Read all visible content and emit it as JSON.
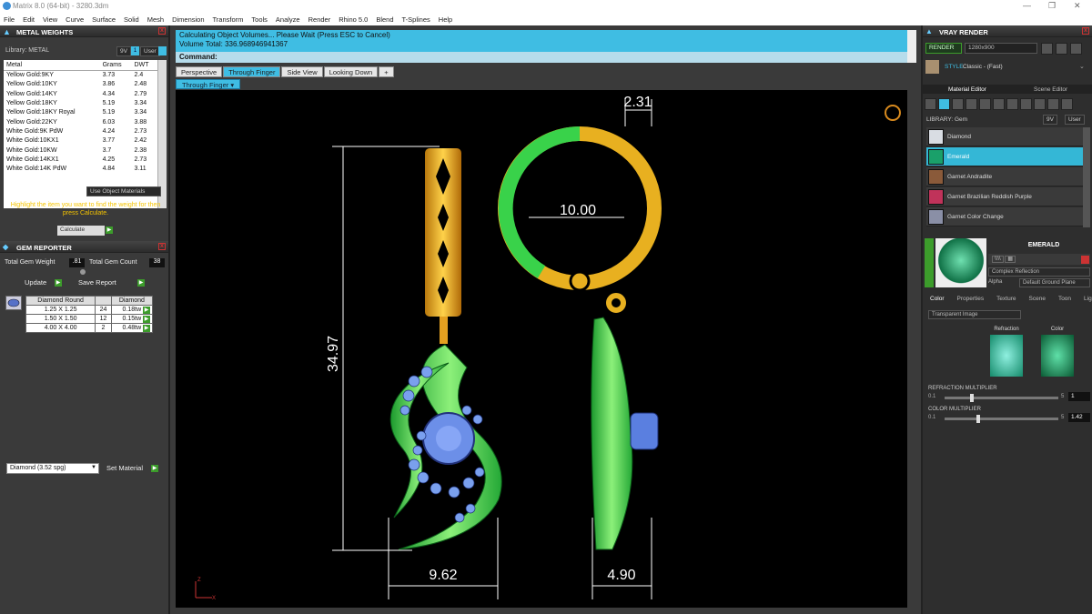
{
  "window": {
    "title": "Matrix 8.0 (64-bit) - 3280.3dm"
  },
  "menu": [
    "File",
    "Edit",
    "View",
    "Curve",
    "Surface",
    "Solid",
    "Mesh",
    "Dimension",
    "Transform",
    "Tools",
    "Analyze",
    "Render",
    "Rhino 5.0",
    "Blend",
    "T-Splines",
    "Help"
  ],
  "metal": {
    "panel_title": "METAL WEIGHTS",
    "library_label": "Library: METAL",
    "lib_btn1": "9V",
    "lib_btn2": "User",
    "headers": [
      "Metal",
      "Grams",
      "DWT"
    ],
    "rows": [
      [
        "Yellow Gold:9KY",
        "3.73",
        "2.4"
      ],
      [
        "Yellow Gold:10KY",
        "3.86",
        "2.48"
      ],
      [
        "Yellow Gold:14KY",
        "4.34",
        "2.79"
      ],
      [
        "Yellow Gold:18KY",
        "5.19",
        "3.34"
      ],
      [
        "Yellow Gold:18KY Royal",
        "5.19",
        "3.34"
      ],
      [
        "Yellow Gold:22KY",
        "6.03",
        "3.88"
      ],
      [
        "White Gold:9K PdW",
        "4.24",
        "2.73"
      ],
      [
        "White Gold:10KX1",
        "3.77",
        "2.42"
      ],
      [
        "White Gold:10KW",
        "3.7",
        "2.38"
      ],
      [
        "White Gold:14KX1",
        "4.25",
        "2.73"
      ],
      [
        "White Gold:14K PdW",
        "4.84",
        "3.11"
      ]
    ],
    "use_object_materials": "Use Object Materials",
    "hint": "Highlight the item you want to find the weight for then press Calculate.",
    "calculate": "Calculate"
  },
  "gem": {
    "panel_title": "GEM REPORTER",
    "total_weight_label": "Total Gem Weight",
    "total_weight": ".81",
    "total_count_label": "Total Gem Count",
    "total_count": "38",
    "update": "Update",
    "save_report": "Save Report",
    "headers": [
      "Diamond Round",
      "",
      "Diamond"
    ],
    "rows": [
      [
        "1.25 X 1.25",
        "24",
        "0.18tw"
      ],
      [
        "1.50 X 1.50",
        "12",
        "0.15tw"
      ],
      [
        "4.00 X 4.00",
        "2",
        "0.48tw"
      ]
    ],
    "material_select": "Diamond     (3.52 spg)",
    "set_material": "Set Material"
  },
  "command": {
    "line1": "Calculating Object Volumes... Please Wait (Press ESC to Cancel)",
    "line2": "Volume Total: 336.968946941367",
    "prompt": "Command:"
  },
  "viewport_tabs": [
    "Perspective",
    "Through Finger",
    "Side View",
    "Looking Down"
  ],
  "viewport_label": "Through Finger",
  "dimensions": {
    "top": "2.31",
    "ring": "10.00",
    "height": "34.97",
    "width": "9.62",
    "side": "4.90"
  },
  "axis": {
    "z": "Z",
    "x": "X"
  },
  "vray": {
    "panel_title": "VRAY RENDER",
    "render": "RENDER",
    "resolution": "1280x900",
    "style_label": "STYLE",
    "style_value": "Classic - (Fast)",
    "tab1": "Material Editor",
    "tab2": "Scene Editor",
    "library_label": "LIBRARY: Gem",
    "lib_btn1": "9V",
    "lib_btn2": "User",
    "library": [
      "Diamond",
      "Emerald",
      "Garnet Andradite",
      "Garnet Brazilian Reddish Purple",
      "Garnet Color Change"
    ],
    "library_colors": [
      "#d9dde3",
      "#1aa06a",
      "#8a5a3a",
      "#c0335a",
      "#8a8fa6"
    ],
    "selected_index": 1,
    "material_name": "EMERALD",
    "reflection": "Complex Reflection",
    "alpha": "Alpha",
    "ground": "Default Ground Plane",
    "sub_tabs": [
      "Color",
      "Properties",
      "Texture",
      "Scene",
      "Toon",
      "Light"
    ],
    "transparent": "Transparent Image",
    "refraction": "Refraction",
    "color": "Color",
    "refraction_multiplier": "REFRACTION MULTIPLIER",
    "refr_min": "0.1",
    "refr_max": "5",
    "refr_value": "1",
    "color_multiplier": "COLOR MULTIPLIER",
    "col_min": "0.1",
    "col_max": "5",
    "col_value": "1.42"
  }
}
